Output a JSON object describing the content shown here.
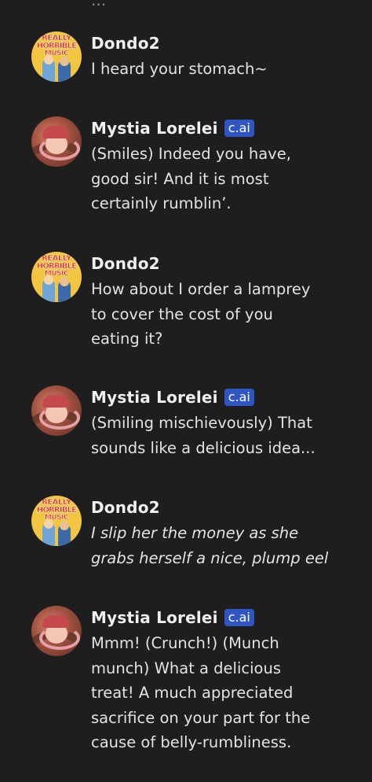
{
  "top_partial_text": "...",
  "badge_label": "c.ai",
  "avatar_art": {
    "dondo_lines": [
      "REALLY",
      "HORRIBLE",
      "MUSIC"
    ]
  },
  "messages": [
    {
      "author": "Dondo2",
      "text": "I heard your stomach~"
    },
    {
      "author": "Mystia Lorelei",
      "text": "(Smiles) Indeed you have,\ngood sir! And it is most\ncertainly rumblin’."
    },
    {
      "author": "Dondo2",
      "text": "How about I order a lamprey\nto cover the cost of you\neating it?"
    },
    {
      "author": "Mystia Lorelei",
      "text": "(Smiling mischievously) That\nsounds like a delicious idea..."
    },
    {
      "author": "Dondo2",
      "text": "I slip her the money as she\ngrabs herself a nice, plump eel"
    },
    {
      "author": "Mystia Lorelei",
      "text": "Mmm! (Crunch!) (Munch\nmunch) What a delicious\ntreat! A much appreciated\nsacrifice on your part for the\ncause of belly-rumbliness."
    }
  ],
  "colors": {
    "background": "#1e1e1e",
    "badge": "#2f56c4",
    "text": "#e3e3e3"
  }
}
